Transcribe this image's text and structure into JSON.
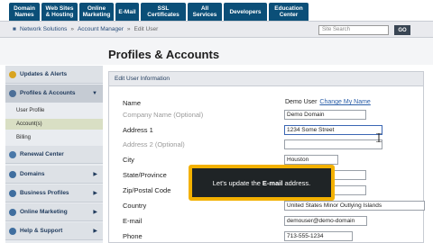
{
  "nav_tabs": [
    {
      "label": "Domain\nNames"
    },
    {
      "label": "Web Sites\n& Hosting"
    },
    {
      "label": "Online\nMarketing"
    },
    {
      "label": "E-Mail"
    },
    {
      "label": "SSL\nCertificates"
    },
    {
      "label": "All\nServices"
    },
    {
      "label": "Developers"
    },
    {
      "label": "Education\nCenter"
    }
  ],
  "breadcrumb": {
    "items": [
      "Network Solutions",
      "Account Manager",
      "Edit User"
    ],
    "sep": "»"
  },
  "search": {
    "placeholder": "Site Search",
    "go_label": "GO"
  },
  "page_title": "Profiles & Accounts",
  "sidebar": {
    "sections": [
      {
        "label": "Updates & Alerts"
      },
      {
        "label": "Profiles & Accounts"
      },
      {
        "label": "Renewal Center"
      },
      {
        "label": "Domains"
      },
      {
        "label": "Business Profiles"
      },
      {
        "label": "Online Marketing"
      },
      {
        "label": "Help & Support"
      }
    ],
    "sub_items": [
      "User Profile",
      "Account(s)",
      "Billing"
    ]
  },
  "panel": {
    "header": "Edit User Information",
    "fields": {
      "name": {
        "label": "Name",
        "value": "Demo User",
        "link": "Change My Name"
      },
      "company": {
        "label": "Company Name (Optional)",
        "value": "Demo Domain"
      },
      "address1": {
        "label": "Address 1",
        "value": "1234 Some Street"
      },
      "address2": {
        "label": "Address 2 (Optional)",
        "value": ""
      },
      "city": {
        "label": "City",
        "value": "Houston"
      },
      "state": {
        "label": "State/Province",
        "value": ""
      },
      "zip": {
        "label": "Zip/Postal Code",
        "value": ""
      },
      "country": {
        "label": "Country",
        "value": "United States Minor Outlying Islands"
      },
      "email": {
        "label": "E-mail",
        "value": "demouser@demo-domain"
      },
      "phone": {
        "label": "Phone",
        "value": "713-555-1234"
      }
    }
  },
  "tooltip": {
    "prefix": "Let's update the",
    "bold": "E-mail",
    "suffix": "address."
  },
  "colors": {
    "tab_bg": "#0b4f78",
    "accent_orange": "#f3b100",
    "link": "#2a5ea8"
  }
}
